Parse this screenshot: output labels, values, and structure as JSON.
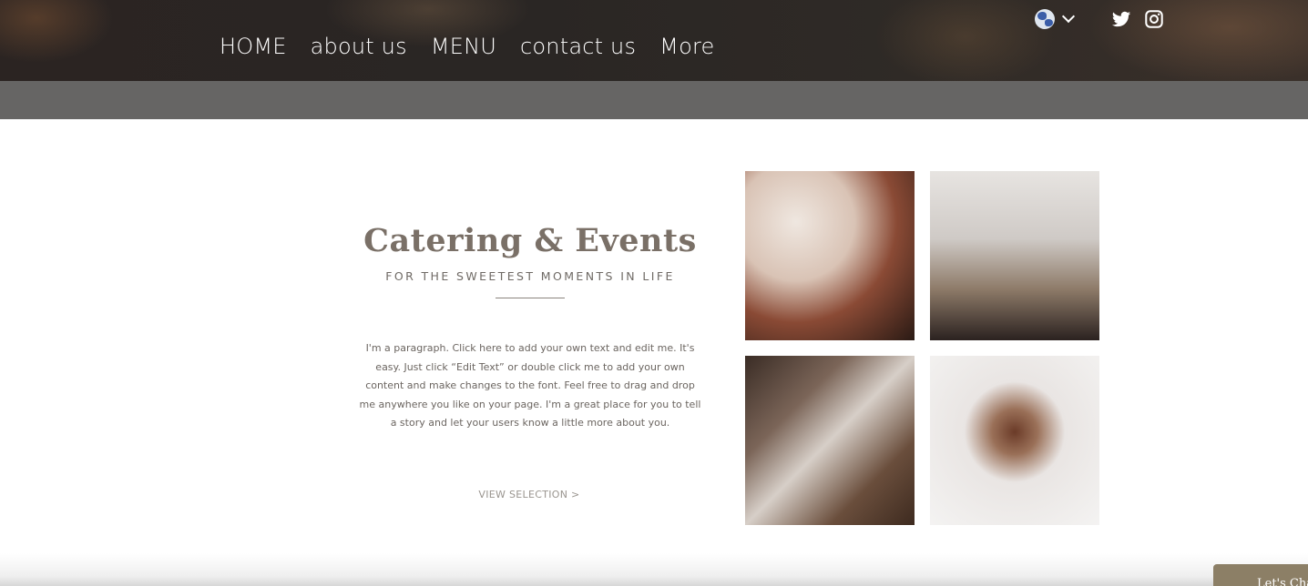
{
  "nav": {
    "items": [
      {
        "label": "HOME"
      },
      {
        "label": "about us"
      },
      {
        "label": "MENU"
      },
      {
        "label": "contact us"
      },
      {
        "label": "More"
      }
    ]
  },
  "header": {
    "language_icon": "globe-icon",
    "social": [
      "twitter-icon",
      "instagram-icon"
    ]
  },
  "section": {
    "title": "Catering & Events",
    "subtitle": "FOR THE SWEETEST MOMENTS IN LIFE",
    "paragraph": "I'm a paragraph. Click here to add your own text and edit me. It's easy. Just click “Edit Text” or double click me to add your own content and make changes to the font. Feel free to drag and drop me anywhere you like on your page. I'm a great place for you to tell a story and let your users know a little more about you.",
    "cta": "VIEW SELECTION >"
  },
  "gallery": {
    "images": [
      "chocolate-truffles-plate",
      "cake-pops",
      "macarons-bowl",
      "truffles-cup"
    ]
  },
  "chat_tab": {
    "label": "Let's Chat!"
  },
  "colors": {
    "header_bg": "#2b2422",
    "band": "#666564",
    "title_text": "#7a7067",
    "body_text": "#6b6560"
  }
}
